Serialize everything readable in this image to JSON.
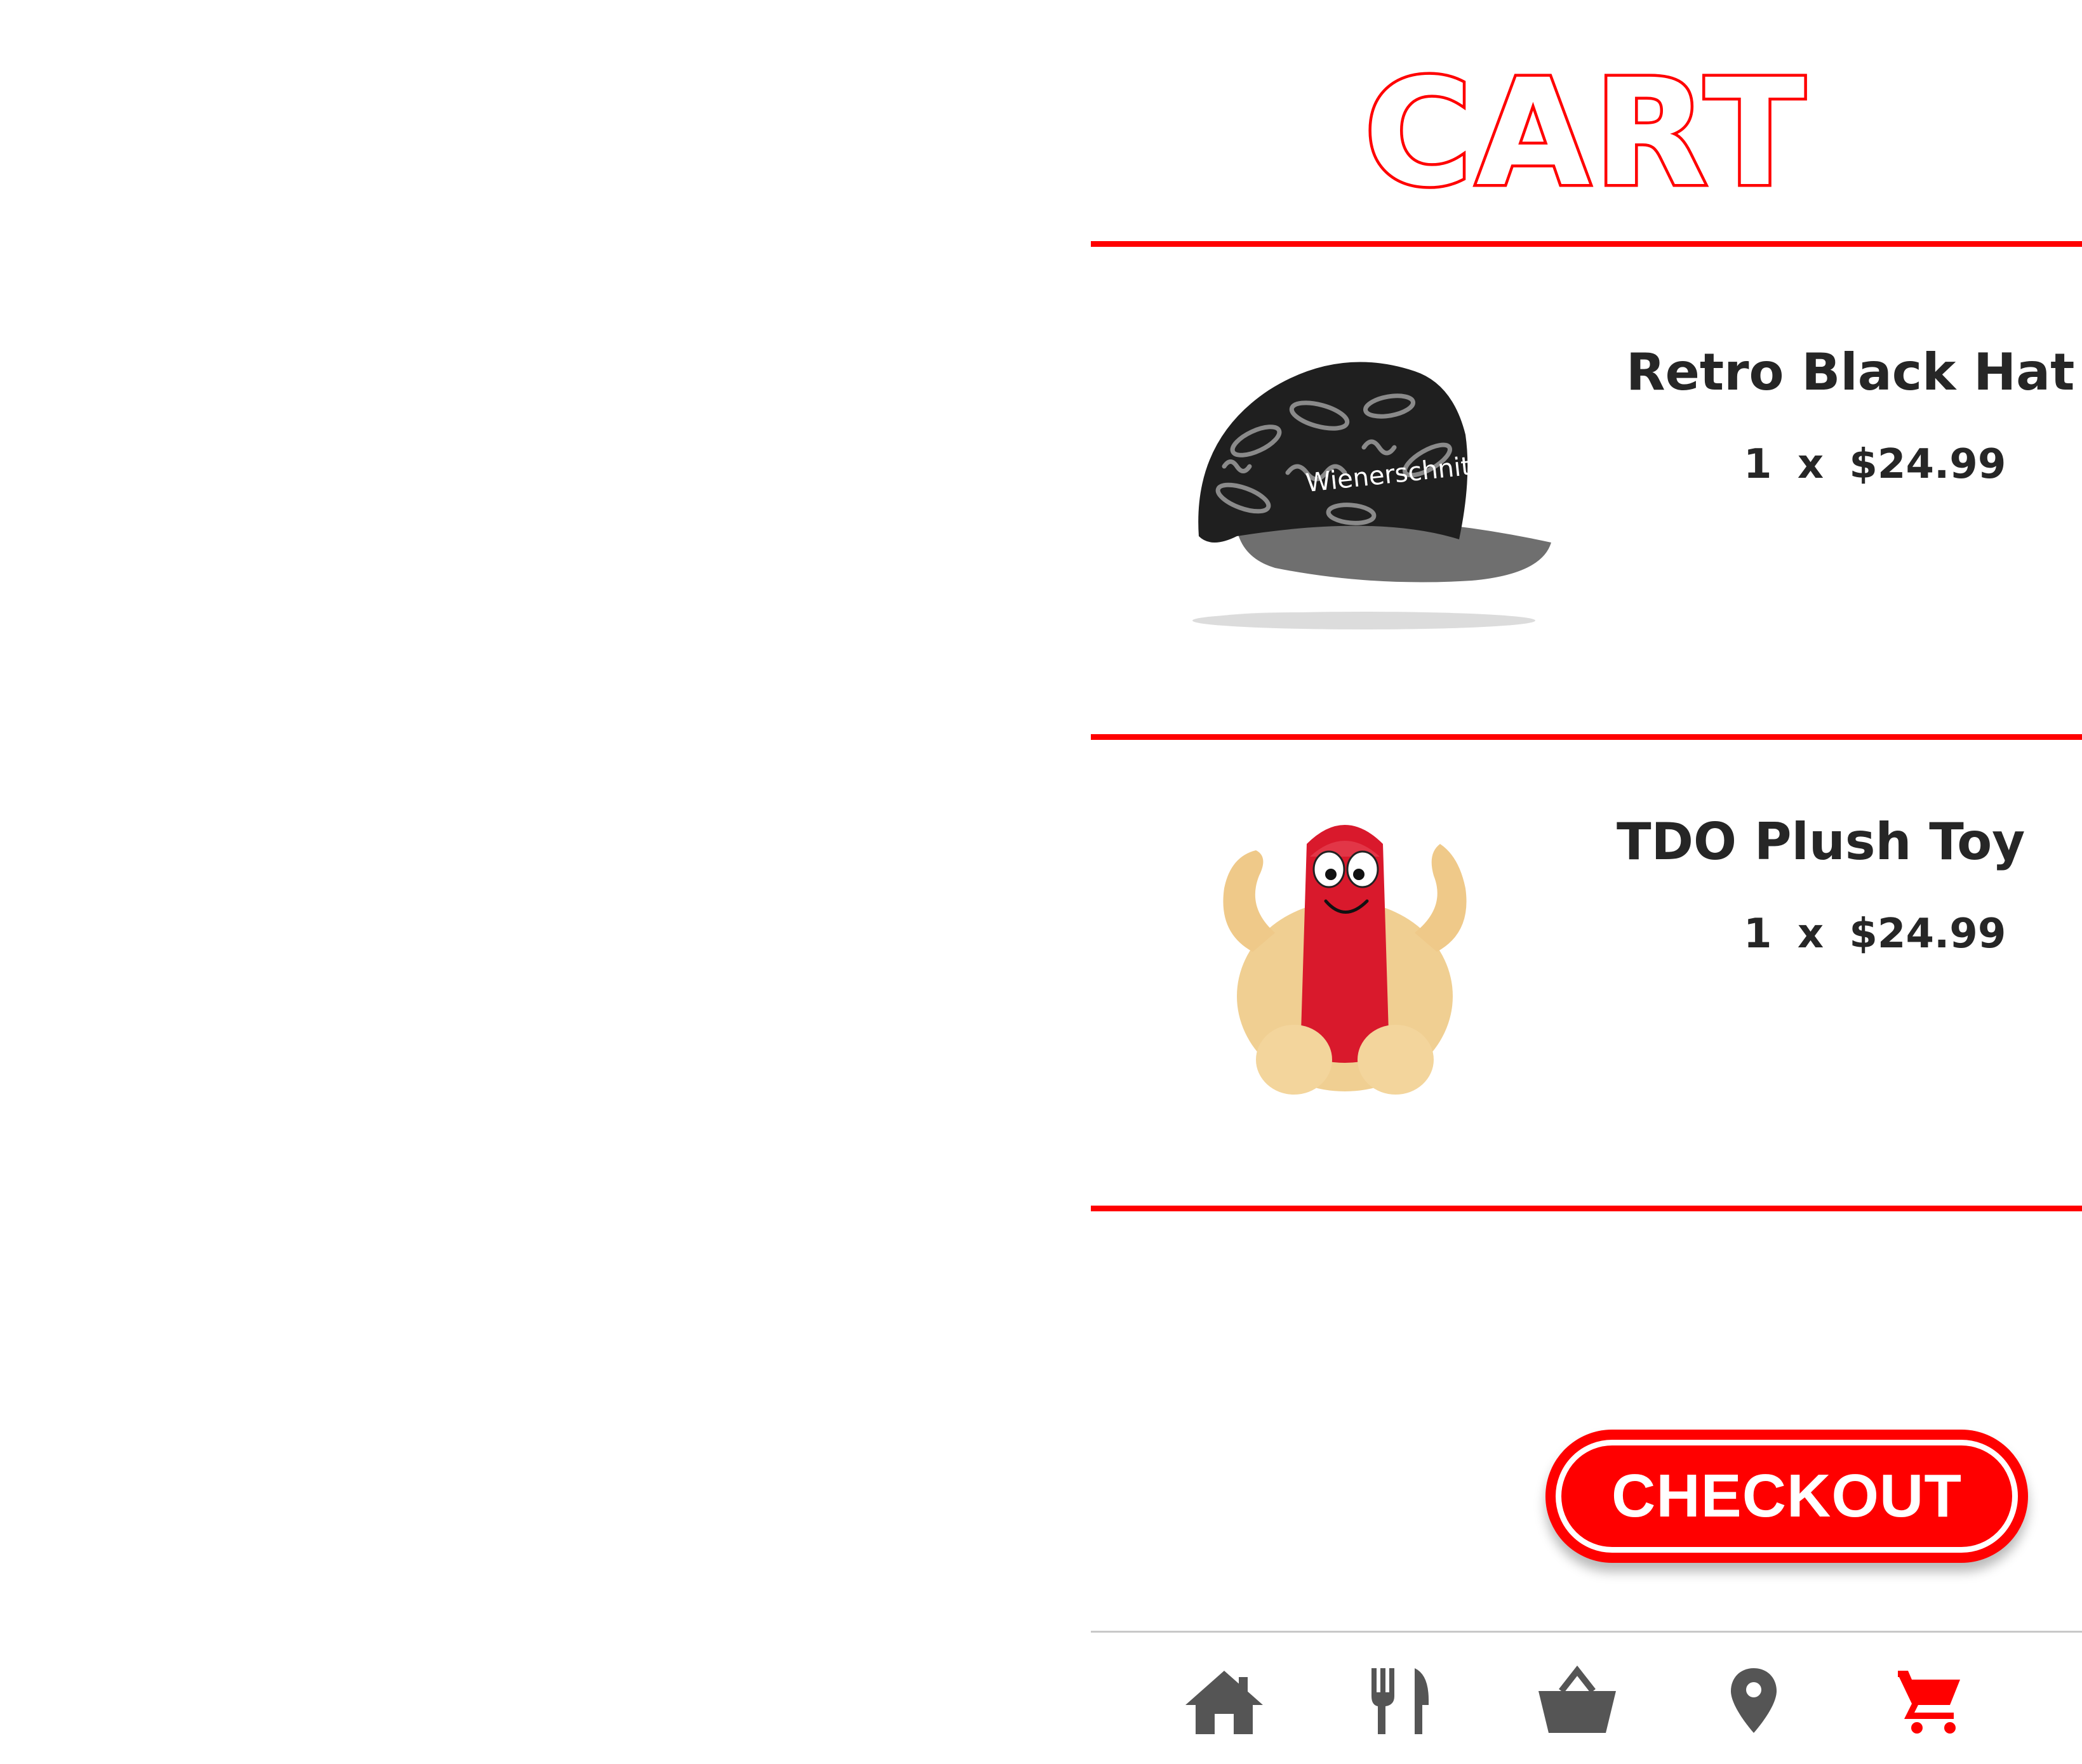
{
  "header": {
    "title": "CART"
  },
  "cart": {
    "items": [
      {
        "name": "Retro Black Hat",
        "qty": "1",
        "times": "x",
        "price": "$24.99",
        "image_text": "Wienerschnitzel"
      },
      {
        "name": "TDO Plush Toy",
        "qty": "1",
        "times": "x",
        "price": "$24.99"
      }
    ]
  },
  "checkout": {
    "label": "CHECKOUT"
  },
  "tabbar": {
    "tabs": [
      {
        "icon": "home-icon",
        "active": false
      },
      {
        "icon": "fork-knife-icon",
        "active": false
      },
      {
        "icon": "basket-icon",
        "active": false
      },
      {
        "icon": "location-pin-icon",
        "active": false
      },
      {
        "icon": "cart-icon",
        "active": true
      }
    ]
  },
  "colors": {
    "accent": "#ff0000",
    "text": "#262626",
    "icon_inactive": "#555555",
    "divider_gray": "#c8c8c8"
  }
}
